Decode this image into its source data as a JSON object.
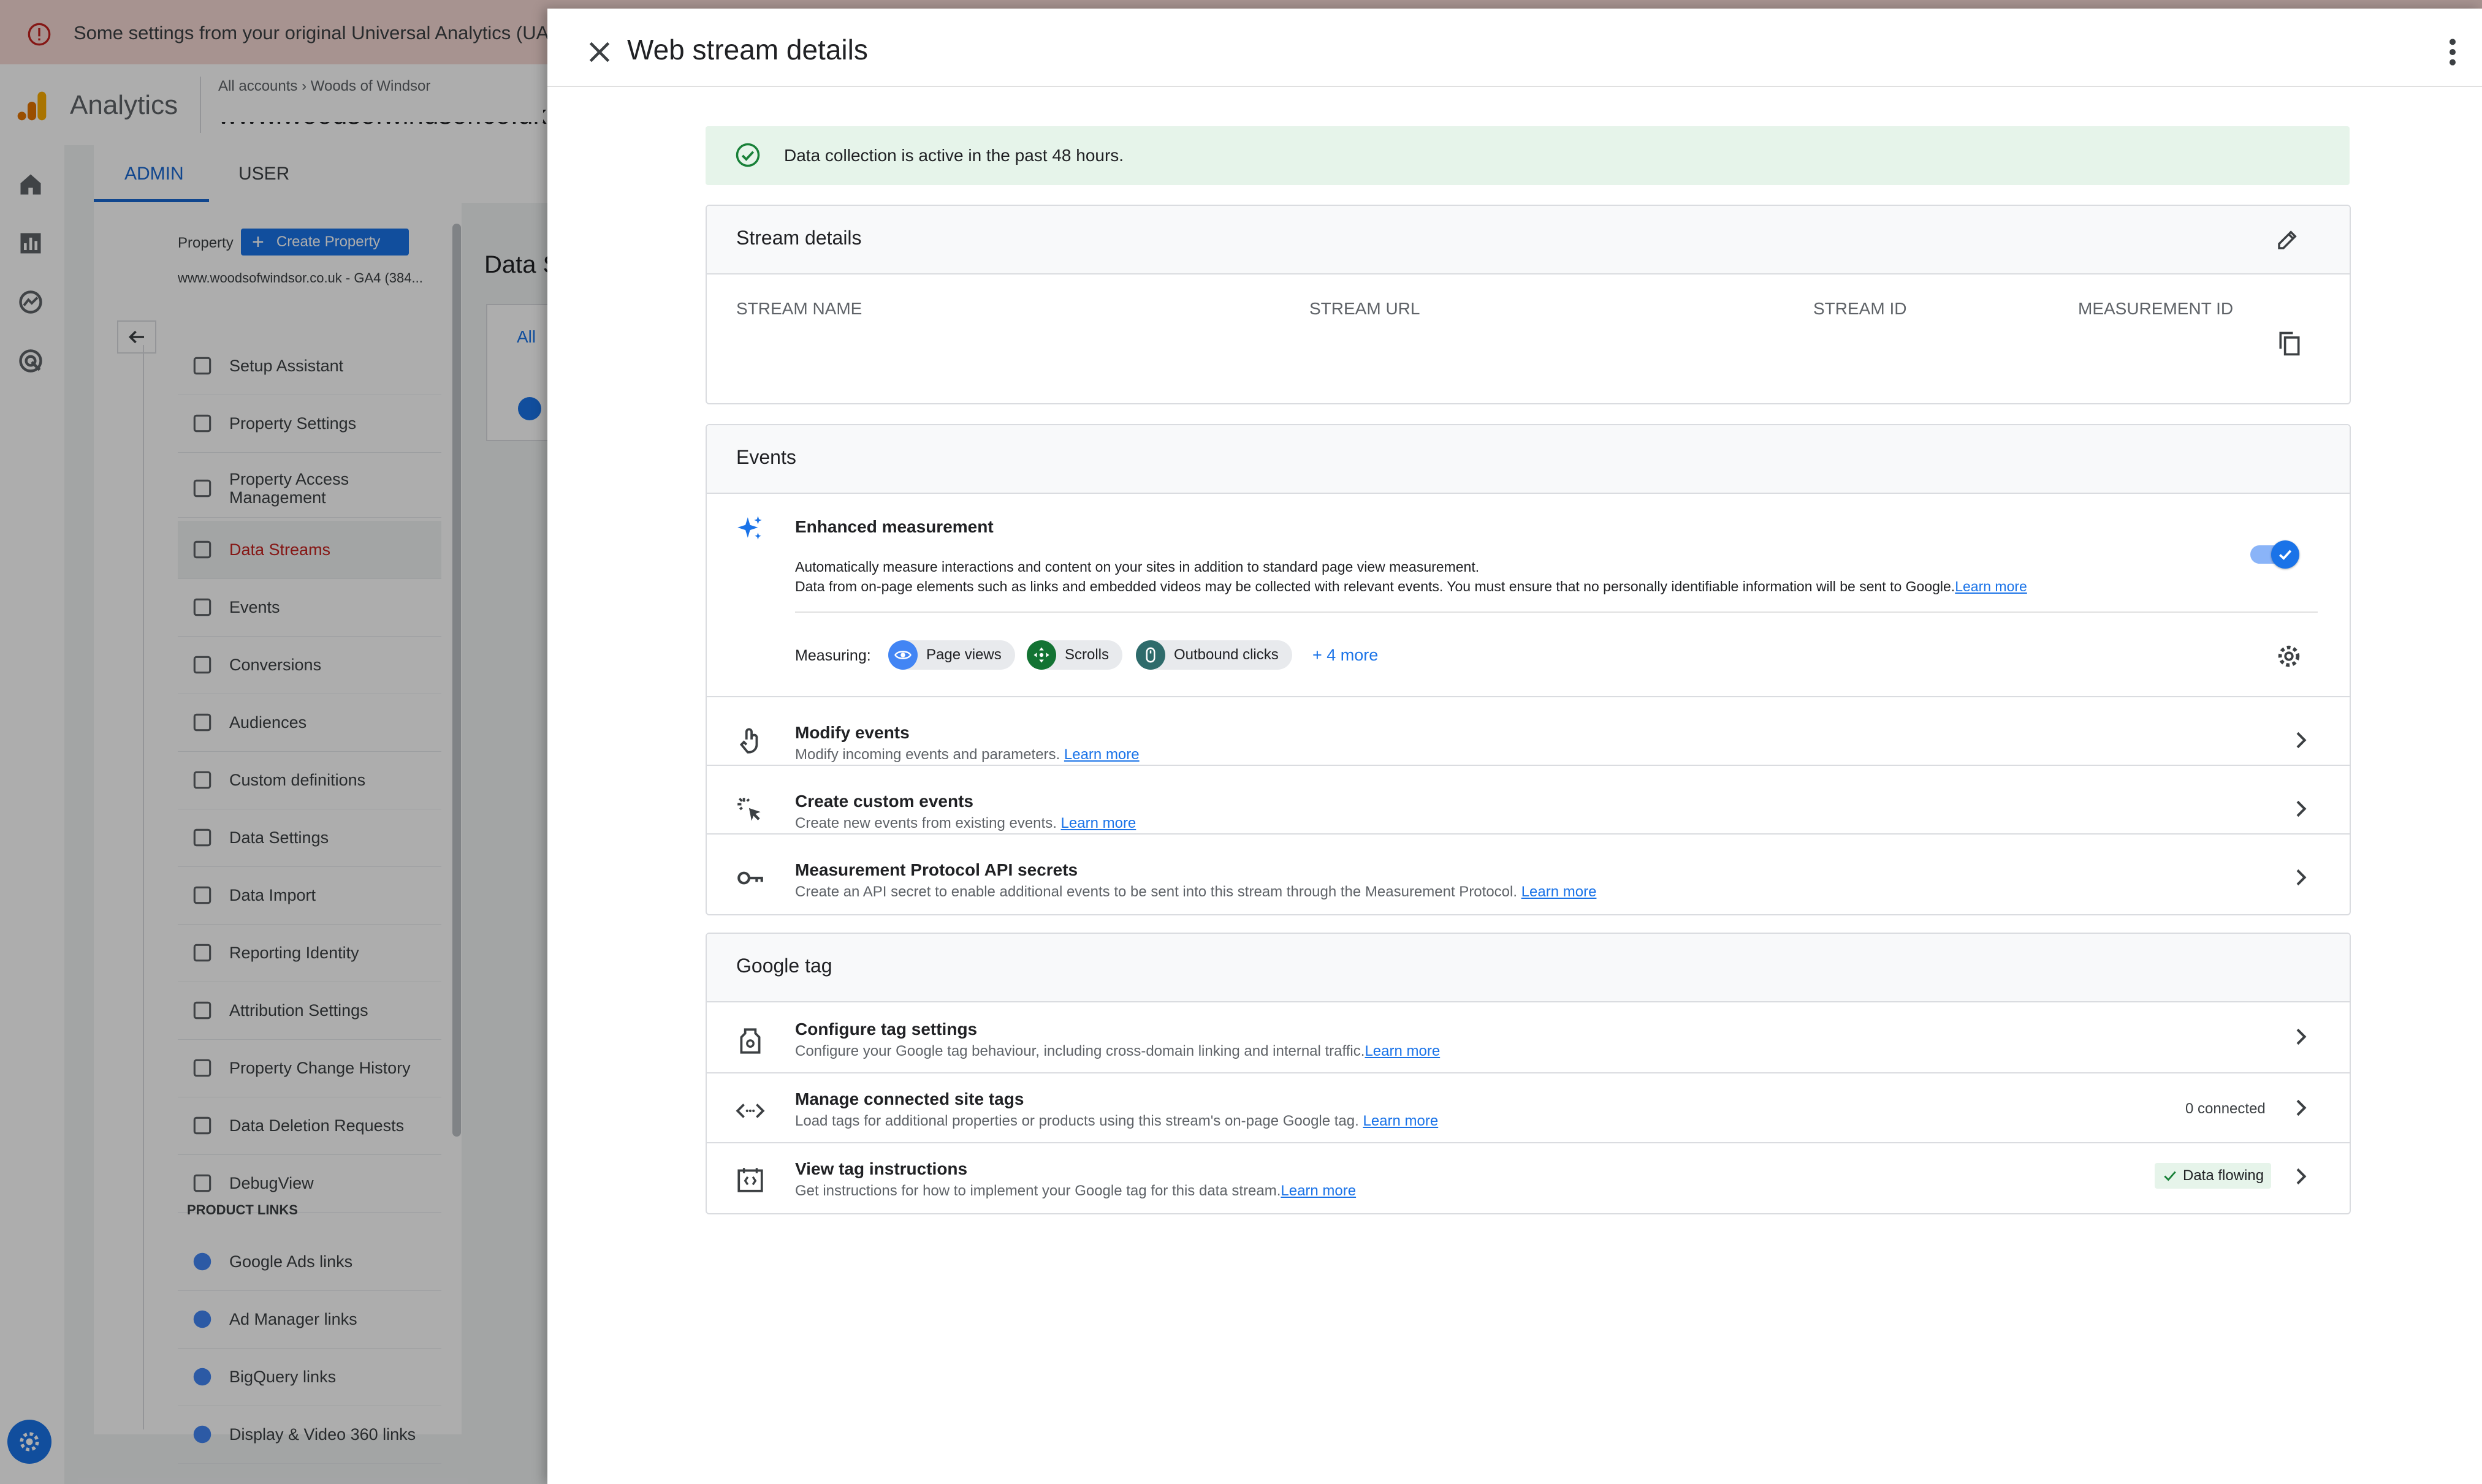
{
  "banner": {
    "text": "Some settings from your original Universal Analytics (UA) pro"
  },
  "app": {
    "name": "Analytics",
    "breadcrumb": {
      "all_accounts": "All accounts",
      "account": "Woods of Windsor"
    },
    "property_selector": "www.woodsofwindsor.co.uk"
  },
  "tabs": {
    "admin": "ADMIN",
    "user": "USER"
  },
  "property_panel": {
    "label": "Property",
    "create_button": "Create Property",
    "property_name": "www.woodsofwindsor.co.uk - GA4 (384...",
    "items": [
      {
        "label": "Setup Assistant",
        "icon": "checkbox-icon"
      },
      {
        "label": "Property Settings",
        "icon": "window-icon"
      },
      {
        "label": "Property Access Management",
        "icon": "people-icon"
      },
      {
        "label": "Data Streams",
        "icon": "streams-icon",
        "active": true
      },
      {
        "label": "Events",
        "icon": "touch-icon"
      },
      {
        "label": "Conversions",
        "icon": "flag-icon"
      },
      {
        "label": "Audiences",
        "icon": "audience-icon"
      },
      {
        "label": "Custom definitions",
        "icon": "shapes-icon"
      },
      {
        "label": "Data Settings",
        "icon": "database-icon"
      },
      {
        "label": "Data Import",
        "icon": "upload-icon"
      },
      {
        "label": "Reporting Identity",
        "icon": "identity-icon"
      },
      {
        "label": "Attribution Settings",
        "icon": "attribution-icon"
      },
      {
        "label": "Property Change History",
        "icon": "history-icon"
      },
      {
        "label": "Data Deletion Requests",
        "icon": "dd-icon"
      },
      {
        "label": "DebugView",
        "icon": "debug-icon"
      }
    ],
    "product_links_heading": "PRODUCT LINKS",
    "product_links": [
      {
        "label": "Google Ads links",
        "icon": "google-ads-icon"
      },
      {
        "label": "Ad Manager links",
        "icon": "ad-manager-icon"
      },
      {
        "label": "BigQuery links",
        "icon": "bigquery-icon"
      },
      {
        "label": "Display & Video 360 links",
        "icon": "dv360-icon"
      }
    ]
  },
  "streams_bg": {
    "title": "Data S",
    "filter_all": "All"
  },
  "drawer": {
    "title": "Web stream details",
    "status": "Data collection is active in the past 48 hours.",
    "stream_details": {
      "title": "Stream details",
      "columns": [
        "STREAM NAME",
        "STREAM URL",
        "STREAM ID",
        "MEASUREMENT ID"
      ]
    },
    "events": {
      "title": "Events",
      "enhanced": {
        "title": "Enhanced measurement",
        "desc1": "Automatically measure interactions and content on your sites in addition to standard page view measurement.",
        "desc2": "Data from on-page elements such as links and embedded videos may be collected with relevant events. You must ensure that no personally identifiable information will be sent to Google.",
        "learn_more": "Learn more",
        "enabled": true,
        "measuring_label": "Measuring:",
        "chips": [
          "Page views",
          "Scrolls",
          "Outbound clicks"
        ],
        "more": "+ 4 more"
      },
      "rows": [
        {
          "title": "Modify events",
          "desc": "Modify incoming events and parameters.",
          "link": "Learn more"
        },
        {
          "title": "Create custom events",
          "desc": "Create new events from existing events.",
          "link": "Learn more"
        },
        {
          "title": "Measurement Protocol API secrets",
          "desc": "Create an API secret to enable additional events to be sent into this stream through the Measurement Protocol.",
          "link": "Learn more"
        }
      ]
    },
    "google_tag": {
      "title": "Google tag",
      "rows": [
        {
          "title": "Configure tag settings",
          "desc": "Configure your Google tag behaviour, including cross-domain linking and internal traffic.",
          "link": "Learn more"
        },
        {
          "title": "Manage connected site tags",
          "desc": "Load tags for additional properties or products using this stream's on-page Google tag.",
          "link": "Learn more",
          "badge": "0 connected"
        },
        {
          "title": "View tag instructions",
          "desc": "Get instructions for how to implement your Google tag for this data stream.",
          "link": "Learn more",
          "badge": "Data flowing"
        }
      ]
    }
  },
  "colors": {
    "accent": "#1a73e8",
    "admin_tab": "#1967d2",
    "error": "#c5221f",
    "success": "#188038",
    "banner_bg": "#f6d9d5",
    "status_bg": "#e6f4ea"
  }
}
